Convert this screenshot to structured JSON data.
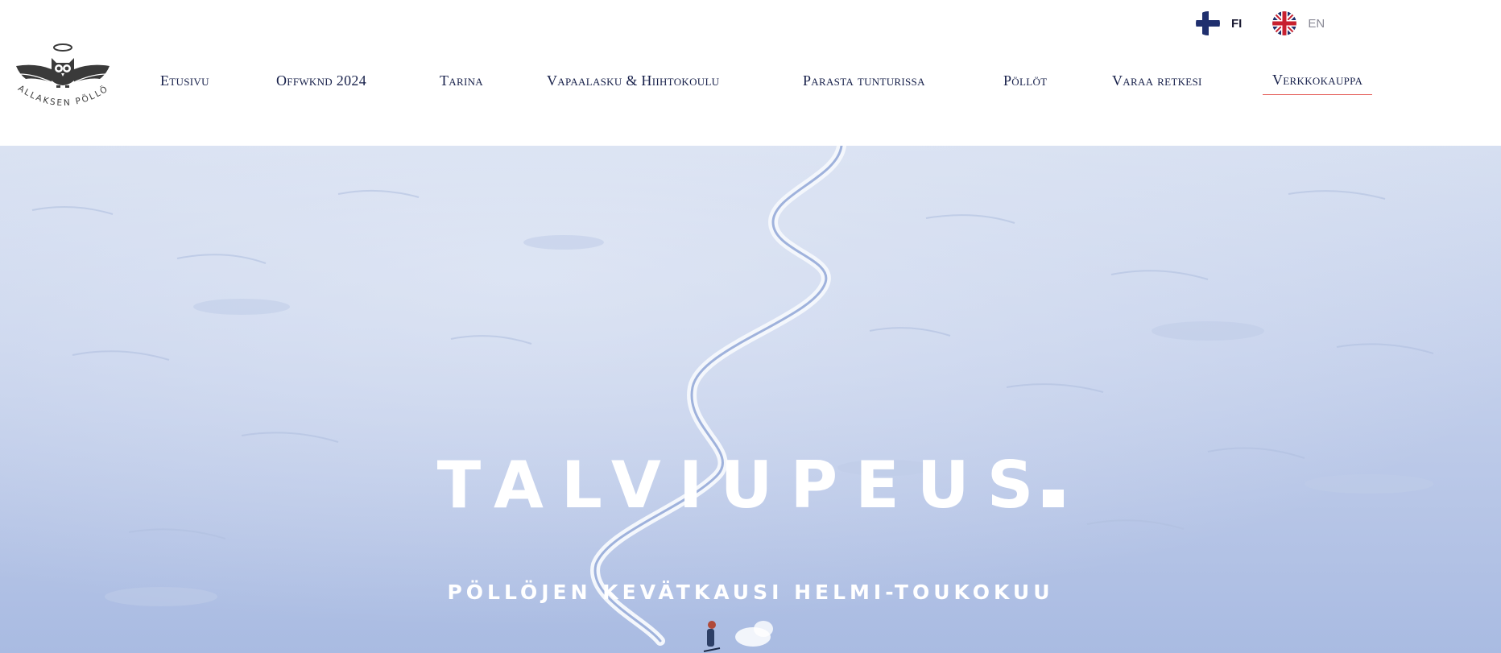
{
  "language_switch": {
    "items": [
      {
        "code": "FI",
        "flag_icon": "finland-flag-icon",
        "active": true
      },
      {
        "code": "EN",
        "flag_icon": "uk-flag-icon",
        "active": false
      }
    ]
  },
  "logo": {
    "text": "PALLAKSEN PÖLLÖT",
    "icon": "winged-owl-icon"
  },
  "nav": {
    "items": [
      {
        "label": "Etusivu"
      },
      {
        "label": "Offwknd 2024"
      },
      {
        "label": "Tarina"
      },
      {
        "label": "Vapaalasku & Hiihtokoulu"
      },
      {
        "label": "Parasta tunturissa"
      },
      {
        "label": "Pöllöt"
      },
      {
        "label": "Varaa retkesi"
      },
      {
        "label": "Verkkokauppa",
        "active": true
      }
    ]
  },
  "hero": {
    "title": "TALVIUPEUS",
    "subtitle": "PÖLLÖJEN KEVÄTKAUSI HELMI-TOUKOKUU"
  },
  "colors": {
    "nav_text": "#17204a",
    "active_underline": "#e5645f",
    "snow_light": "#d6dff1",
    "snow_dark": "#a9bbe2",
    "hero_text": "#ffffff"
  }
}
